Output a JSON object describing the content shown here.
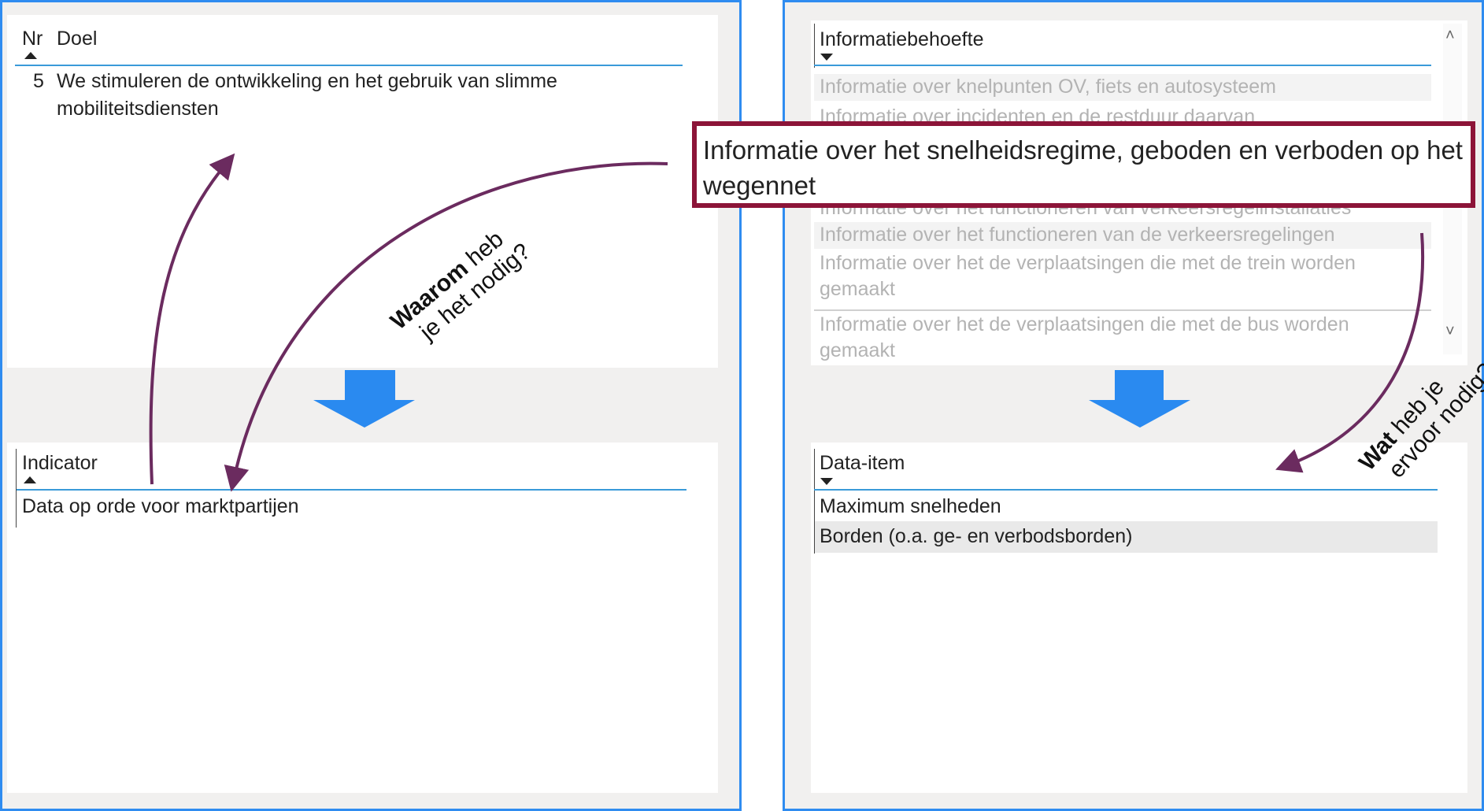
{
  "left_top": {
    "col_nr": "Nr",
    "col_doel": "Doel",
    "rows": [
      {
        "nr": "5",
        "doel": "We stimuleren de ontwikkeling en het gebruik van slimme mobiliteitsdiensten"
      }
    ]
  },
  "left_bottom": {
    "col_indicator": "Indicator",
    "rows": [
      "Data op orde voor marktpartijen"
    ]
  },
  "right_top": {
    "col_informatiebehoefte": "Informatiebehoefte",
    "rows": [
      "Informatie over knelpunten OV, fiets en autosysteem",
      "Informatie over incidenten en de restduur daarvan",
      "Informatie over het functioneren van verkeersregelinstallaties",
      "Informatie over het functioneren van de verkeersregelingen",
      "Informatie over het de verplaatsingen die met de trein worden gemaakt",
      "Informatie over het de verplaatsingen die met de bus worden gemaakt"
    ]
  },
  "highlight_text": "Informatie over het snelheidsregime, geboden en verboden op het wegennet",
  "right_bottom": {
    "col_data_item": "Data-item",
    "rows": [
      "Maximum snelheden",
      "Borden (o.a. ge- en verbodsborden)"
    ]
  },
  "annotation_waarom": {
    "bold": "Waarom",
    "rest1": " heb",
    "line2": "je het nodig?"
  },
  "annotation_wat": {
    "bold": "Wat",
    "rest1": " heb je",
    "line2": "ervoor nodig?"
  },
  "colors": {
    "frame_border": "#2f8cf0",
    "flow_arrow": "#2a8af0",
    "curve_arrow": "#6b2b5f",
    "highlight_border": "#8c1438"
  }
}
